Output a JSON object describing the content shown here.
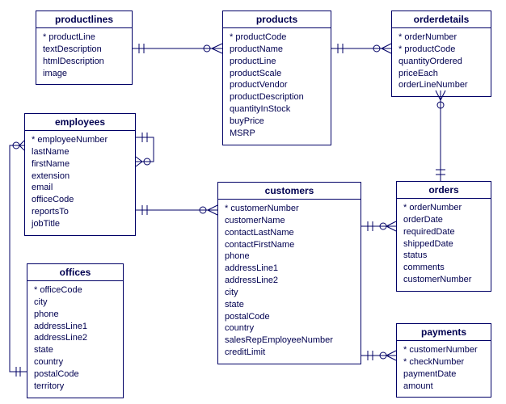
{
  "entities": {
    "productlines": {
      "title": "productlines",
      "pk": [
        "productLine"
      ],
      "attrs": [
        "productLine",
        "textDescription",
        "htmlDescription",
        "image"
      ]
    },
    "products": {
      "title": "products",
      "pk": [
        "productCode"
      ],
      "attrs": [
        "productCode",
        "productName",
        "productLine",
        "productScale",
        "productVendor",
        "productDescription",
        "quantityInStock",
        "buyPrice",
        "MSRP"
      ]
    },
    "orderdetails": {
      "title": "orderdetails",
      "pk": [
        "orderNumber",
        "productCode"
      ],
      "attrs": [
        "orderNumber",
        "productCode",
        "quantityOrdered",
        "priceEach",
        "orderLineNumber"
      ]
    },
    "employees": {
      "title": "employees",
      "pk": [
        "employeeNumber"
      ],
      "attrs": [
        "employeeNumber",
        "lastName",
        "firstName",
        "extension",
        "email",
        "officeCode",
        "reportsTo",
        "jobTitle"
      ]
    },
    "customers": {
      "title": "customers",
      "pk": [
        "customerNumber"
      ],
      "attrs": [
        "customerNumber",
        "customerName",
        "contactLastName",
        "contactFirstName",
        "phone",
        "addressLine1",
        "addressLine2",
        "city",
        "state",
        "postalCode",
        "country",
        "salesRepEmployeeNumber",
        "creditLimit"
      ]
    },
    "orders": {
      "title": "orders",
      "pk": [
        "orderNumber"
      ],
      "attrs": [
        "orderNumber",
        "orderDate",
        "requiredDate",
        "shippedDate",
        "status",
        "comments",
        "customerNumber"
      ]
    },
    "offices": {
      "title": "offices",
      "pk": [
        "officeCode"
      ],
      "attrs": [
        "officeCode",
        "city",
        "phone",
        "addressLine1",
        "addressLine2",
        "state",
        "country",
        "postalCode",
        "territory"
      ]
    },
    "payments": {
      "title": "payments",
      "pk": [
        "customerNumber",
        "checkNumber"
      ],
      "attrs": [
        "customerNumber",
        "checkNumber",
        "paymentDate",
        "amount"
      ]
    }
  },
  "relationships": [
    {
      "from": "productlines",
      "to": "products",
      "type": "one-to-many"
    },
    {
      "from": "products",
      "to": "orderdetails",
      "type": "one-to-many"
    },
    {
      "from": "orders",
      "to": "orderdetails",
      "type": "one-to-many"
    },
    {
      "from": "customers",
      "to": "orders",
      "type": "one-to-many"
    },
    {
      "from": "customers",
      "to": "payments",
      "type": "one-to-many"
    },
    {
      "from": "employees",
      "to": "customers",
      "type": "one-to-many"
    },
    {
      "from": "employees",
      "to": "employees",
      "type": "self-one-to-many"
    },
    {
      "from": "offices",
      "to": "employees",
      "type": "one-to-many"
    }
  ]
}
